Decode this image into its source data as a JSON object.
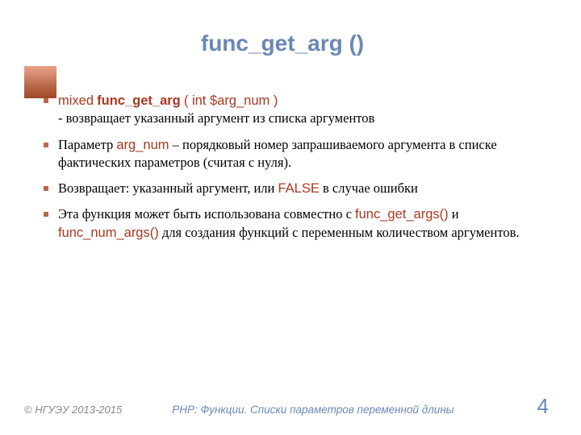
{
  "title": "func_get_arg ()",
  "bullets": {
    "b1": {
      "sig_type": "mixed",
      "sig_name": "func_get_arg",
      "sig_args": " ( int $arg_num )",
      "desc_prefix": "- ",
      "desc": "возвращает указанный аргумент из списка аргументов"
    },
    "b2": {
      "pre": "Параметр ",
      "code": "arg_num",
      "post": " – порядковый номер запрашиваемого аргумента в списке фактических параметров (считая с нуля)."
    },
    "b3": {
      "pre": "Возвращает: указанный аргумент, или ",
      "code": "FALSE",
      "post": " в случае ошибки"
    },
    "b4": {
      "pre": "Эта функция может быть использована совместно с ",
      "code1": "func_get_args()",
      "mid": " и ",
      "code2": "func_num_args()",
      "post": " для создания функций с переменным количеством аргументов."
    }
  },
  "footer": {
    "copyright": "© НГУЭУ 2013-2015",
    "text": "PHP: Функции. Списки параметров переменной длины",
    "page": "4"
  }
}
